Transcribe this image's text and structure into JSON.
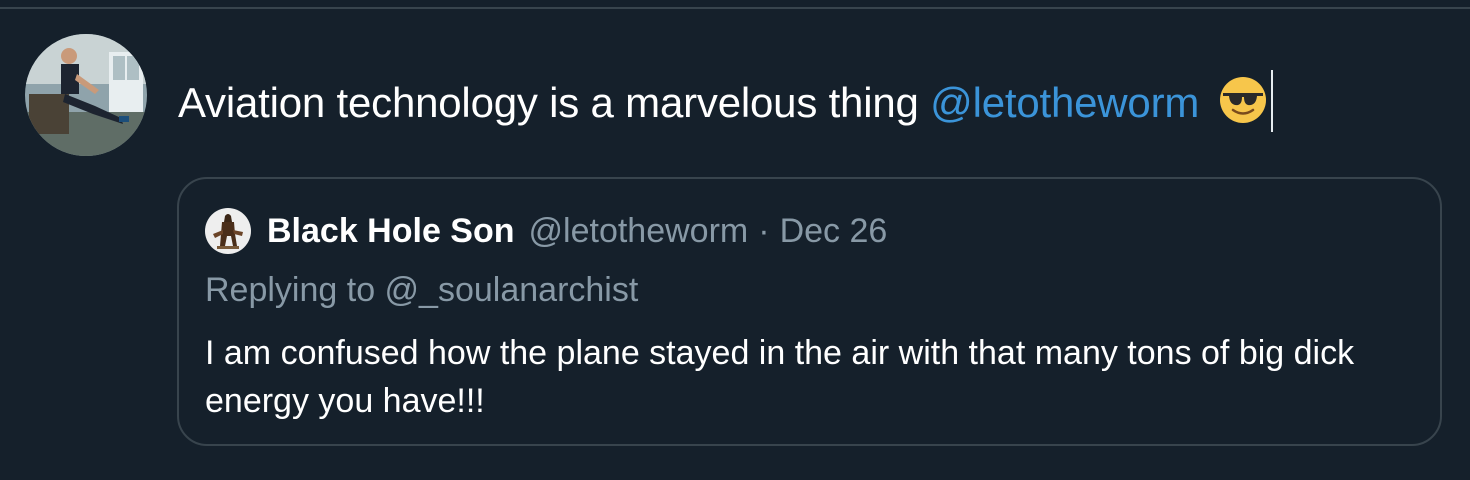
{
  "composer": {
    "text": "Aviation technology is a marvelous thing",
    "mention": "@letotheworm",
    "emoji": "smiling-face-with-sunglasses-icon"
  },
  "quoted_tweet": {
    "author_name": "Black Hole Son",
    "author_handle": "@letotheworm",
    "separator": "·",
    "date": "Dec 26",
    "replying_to": "Replying to @_soulanarchist",
    "body": "I am confused how the plane stayed in the air with that many tons of big dick energy you have!!!"
  },
  "colors": {
    "background": "#15202b",
    "border": "#38444d",
    "text_primary": "#ffffff",
    "text_secondary": "#8899a6",
    "mention": "#3b94d9"
  }
}
